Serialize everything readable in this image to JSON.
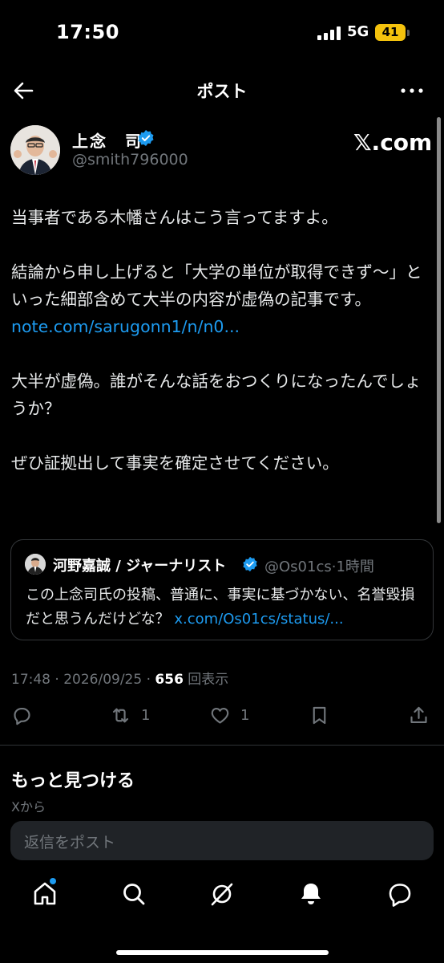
{
  "status_bar": {
    "time": "17:50",
    "network": "5G",
    "battery": "41"
  },
  "header": {
    "title": "ポスト"
  },
  "author": {
    "name": "上念　司",
    "handle": "@smith796000"
  },
  "watermark": "𝕏.com",
  "post": {
    "line1": "当事者である木幡さんはこう言ってますよ。",
    "line2": "結論から申し上げると「大学の単位が取得できず〜」といった細部含めて大半の内容が虚偽の記事です。",
    "link": "note.com/sarugonn1/n/n0...",
    "line3": "大半が虚偽。誰がそんな話をおつくりになったんでしょうか？",
    "line4": "ぜひ証拠出して事実を確定させてください。"
  },
  "quote": {
    "name": "河野嘉誠 / ジャーナリスト",
    "handle": "@Os01cs",
    "time": "·1時間",
    "text": "この上念司氏の投稿、普通に、事実に基づかない、名誉毀損だと思うんだけどな？ ",
    "link": "x.com/Os01cs/status/..."
  },
  "meta": {
    "time": "17:48 · 2026/09/25 · ",
    "views": "656",
    "views_label": " 回表示"
  },
  "actions": {
    "retweets": "1",
    "likes": "1"
  },
  "discover": {
    "title": "もっと見つける",
    "subtitle": "Xから"
  },
  "reply": {
    "placeholder": "返信をポスト"
  },
  "colors": {
    "accent": "#1d9bf0",
    "background": "#000000",
    "muted": "#71767b",
    "battery": "#f4c20d"
  },
  "icons": [
    "back-arrow-icon",
    "more-icon",
    "verified-icon",
    "reply-icon",
    "retweet-icon",
    "like-icon",
    "bookmark-icon",
    "share-icon",
    "home-icon",
    "search-icon",
    "grok-icon",
    "notifications-icon",
    "messages-icon"
  ]
}
